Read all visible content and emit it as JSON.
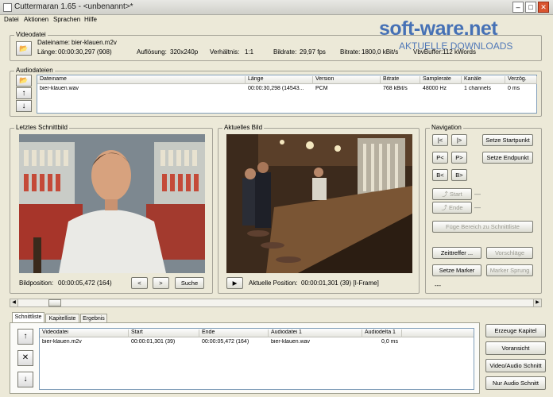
{
  "window": {
    "title": "Cuttermaran 1.65 - <unbenannt>*"
  },
  "menu": [
    "Datei",
    "Aktionen",
    "Sprachen",
    "Hilfe"
  ],
  "watermark": {
    "brand": "soft-ware.net",
    "tagline": "AKTUELLE DOWNLOADS"
  },
  "video": {
    "group_label": "Videodatei",
    "filename_label": "Dateiname:",
    "filename": "bier-klauen.m2v",
    "length_label": "Länge:",
    "length": "00:00:30,297 (908)",
    "resolution_label": "Auflösung:",
    "resolution": "320x240p",
    "ratio_label": "Verhältnis:",
    "ratio": "1:1",
    "framerate_label": "Bildrate:",
    "framerate": "29,97 fps",
    "bitrate_label": "Bitrate:",
    "bitrate": "1800,0 kBit/s",
    "vbv_label": "VbvBuffer:",
    "vbv": "112 kWords"
  },
  "audio": {
    "group_label": "Audiodateien",
    "columns": [
      "Dateiname",
      "Länge",
      "Version",
      "Bitrate",
      "Samplerate",
      "Kanäle",
      "Verzög."
    ],
    "rows": [
      [
        "bier-klauen.wav",
        "00:00:30,298 (14543...",
        "PCM",
        "768 kBit/s",
        "48000 Hz",
        "1 channels",
        "0 ms"
      ]
    ]
  },
  "last_frame": {
    "group_label": "Letztes Schnittbild",
    "pos_label": "Bildposition:",
    "pos_value": "00:00:05,472 (164)",
    "prev": "<",
    "next": ">",
    "search": "Suche"
  },
  "current_frame": {
    "group_label": "Aktuelles Bild",
    "play": "▶",
    "pos_label": "Aktuelle Position:",
    "pos_value": "00:00:01,301 (39) [I-Frame]"
  },
  "navigation": {
    "group_label": "Navigation",
    "b1": "|<",
    "b2": "|>",
    "b3": "P<",
    "b4": "P>",
    "b5": "B<",
    "b6": "B>",
    "set_start": "Setze Startpunkt",
    "set_end": "Setze Endpunkt",
    "start": "Start",
    "end": "Ende",
    "add_range": "Füge Bereich zu Schnittliste",
    "time_hit": "Zeittreffer ...",
    "suggestions": "Vorschläge",
    "set_marker": "Setze Marker",
    "marker_jump": "Marker Sprung",
    "status": "---"
  },
  "tabs": [
    "Schnittliste",
    "Kapitelliste",
    "Ergebnis"
  ],
  "cutlist": {
    "columns": [
      "Videodatei",
      "Start",
      "Ende",
      "Audiodatei 1",
      "Audiodelta 1"
    ],
    "rows": [
      [
        "bier-klauen.m2v",
        "00:00:01,301 (39)",
        "00:00:05,472 (164)",
        "bier-klauen.wav",
        "0,0 ms"
      ]
    ]
  },
  "actions": {
    "chapter": "Erzeuge Kapitel",
    "preview": "Voransicht",
    "video_audio_cut": "Video/Audio Schnitt",
    "audio_cut": "Nur Audio Schnitt"
  },
  "timeline": {
    "position": 0.06
  },
  "colors": {
    "accent": "#1f5fa8",
    "watermark": "#2a5db0"
  }
}
